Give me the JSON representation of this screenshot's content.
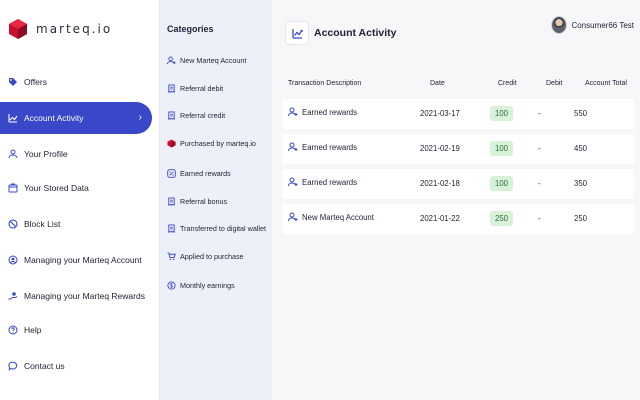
{
  "brand": {
    "name": "marteq.io",
    "color": "#c8102e"
  },
  "accent": "#3848c8",
  "sidebar": {
    "items": [
      {
        "label": "Offers",
        "icon": "tag-icon"
      },
      {
        "label": "Account Activity",
        "icon": "trending-up-icon",
        "active": true
      },
      {
        "label": "Your Profile",
        "icon": "user-icon"
      },
      {
        "label": "Your Stored Data",
        "icon": "database-icon"
      },
      {
        "label": "Block List",
        "icon": "block-icon"
      },
      {
        "label": "Managing your Marteq Account",
        "icon": "account-circle-icon"
      },
      {
        "label": "Managing your Marteq Rewards",
        "icon": "hand-coin-icon"
      },
      {
        "label": "Help",
        "icon": "help-icon"
      },
      {
        "label": "Contact us",
        "icon": "chat-icon"
      }
    ]
  },
  "categories": {
    "title": "Categories",
    "items": [
      {
        "label": "New Marteq Account",
        "icon": "user-add-icon"
      },
      {
        "label": "Referral debit",
        "icon": "receipt-icon"
      },
      {
        "label": "Referral credit",
        "icon": "receipt-icon"
      },
      {
        "label": "Purchased by marteq.io",
        "icon": "marteq-logo-icon"
      },
      {
        "label": "Earned rewards",
        "icon": "percent-icon"
      },
      {
        "label": "Referral bonus",
        "icon": "receipt-icon"
      },
      {
        "label": "Transferred to digital wallet",
        "icon": "wallet-icon"
      },
      {
        "label": "Applied to purchase",
        "icon": "cart-icon"
      },
      {
        "label": "Monthly earnings",
        "icon": "coins-icon"
      }
    ]
  },
  "header": {
    "title": "Account Activity",
    "icon": "trending-up-icon"
  },
  "user": {
    "name": "Consumer66 Test"
  },
  "table": {
    "columns": [
      "Transaction Description",
      "Date",
      "Credit",
      "Debit",
      "Account Total"
    ],
    "rows": [
      {
        "description": "Earned rewards",
        "date": "2021-03-17",
        "credit": "100",
        "debit": "-",
        "total": "550"
      },
      {
        "description": "Earned rewards",
        "date": "2021-02-19",
        "credit": "100",
        "debit": "-",
        "total": "450"
      },
      {
        "description": "Earned rewards",
        "date": "2021-02-18",
        "credit": "100",
        "debit": "-",
        "total": "350"
      },
      {
        "description": "New Marteq Account",
        "date": "2021-01-22",
        "credit": "250",
        "debit": "-",
        "total": "250"
      }
    ]
  }
}
